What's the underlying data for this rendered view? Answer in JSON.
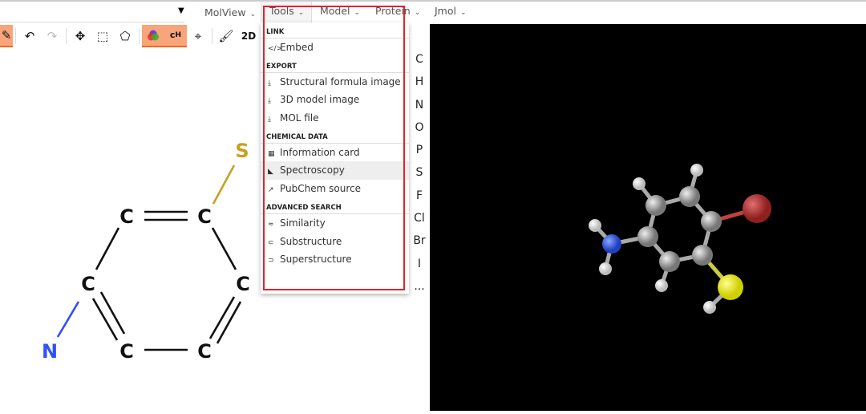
{
  "topbar": {
    "menus": [
      {
        "label": "MolView"
      },
      {
        "label": "Tools"
      },
      {
        "label": "Model"
      },
      {
        "label": "Protein"
      },
      {
        "label": "Jmol"
      }
    ]
  },
  "toolbar": {
    "mode_2d_label": "2D"
  },
  "elements": [
    "C",
    "H",
    "N",
    "O",
    "P",
    "S",
    "F",
    "Cl",
    "Br",
    "I",
    "..."
  ],
  "structure2d": {
    "atoms": [
      "S",
      "C",
      "C",
      "C",
      "C",
      "C",
      "C",
      "N"
    ]
  },
  "tools_menu": {
    "sections": [
      {
        "title": "LINK",
        "items": [
          {
            "icon": "code-icon",
            "glyph": "</>",
            "label": "Embed"
          }
        ]
      },
      {
        "title": "EXPORT",
        "items": [
          {
            "icon": "download-icon",
            "glyph": "⤓",
            "label": "Structural formula image"
          },
          {
            "icon": "download-icon",
            "glyph": "⤓",
            "label": "3D model image"
          },
          {
            "icon": "download-icon",
            "glyph": "⤓",
            "label": "MOL file"
          }
        ]
      },
      {
        "title": "CHEMICAL DATA",
        "items": [
          {
            "icon": "table-icon",
            "glyph": "▦",
            "label": "Information card"
          },
          {
            "icon": "chart-icon",
            "glyph": "◣",
            "label": "Spectroscopy",
            "hover": true
          },
          {
            "icon": "external-link-icon",
            "glyph": "↗",
            "label": "PubChem source"
          }
        ]
      },
      {
        "title": "ADVANCED SEARCH",
        "items": [
          {
            "icon": "approx-icon",
            "glyph": "≈",
            "label": "Similarity"
          },
          {
            "icon": "subset-icon",
            "glyph": "⊂",
            "label": "Substructure"
          },
          {
            "icon": "superset-icon",
            "glyph": "⊃",
            "label": "Superstructure"
          }
        ]
      }
    ]
  },
  "colors": {
    "highlight": "#e8202a",
    "active_tool": "#f8a57b",
    "carbon": "#111111",
    "nitrogen": "#3050f8",
    "sulfur": "#c8a020",
    "bromine": "#b03030"
  }
}
